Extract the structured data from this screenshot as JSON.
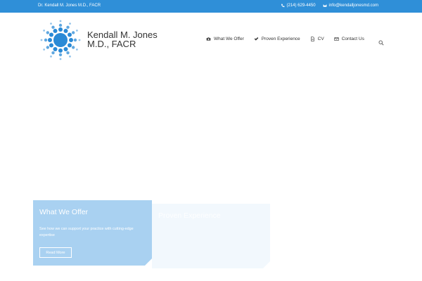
{
  "topbar": {
    "site_name": "Dr. Kendall M. Jones M.D., FACR",
    "phone": "(214) 629-4450",
    "email": "info@kendalljonesmd.com"
  },
  "logo": {
    "line1": "Kendall M. Jones",
    "line2": "M.D., FACR"
  },
  "nav": {
    "items": [
      {
        "label": "What We Offer",
        "icon": "camera-icon"
      },
      {
        "label": "Proven Experience",
        "icon": "check-icon"
      },
      {
        "label": "CV",
        "icon": "document-icon"
      },
      {
        "label": "Contact Us",
        "icon": "envelope-icon"
      }
    ],
    "search_icon": "search-icon"
  },
  "cards": [
    {
      "title": "What We Offer",
      "description": "See how we can support your practice with cutting-edge expertise",
      "button": "Read More"
    },
    {
      "title": "Proven Experience",
      "description": "",
      "button": ""
    }
  ],
  "colors": {
    "topbar": "#2f8fd8",
    "card_primary": "#a9d1f1",
    "logo_blue": "#2a8ad6"
  }
}
